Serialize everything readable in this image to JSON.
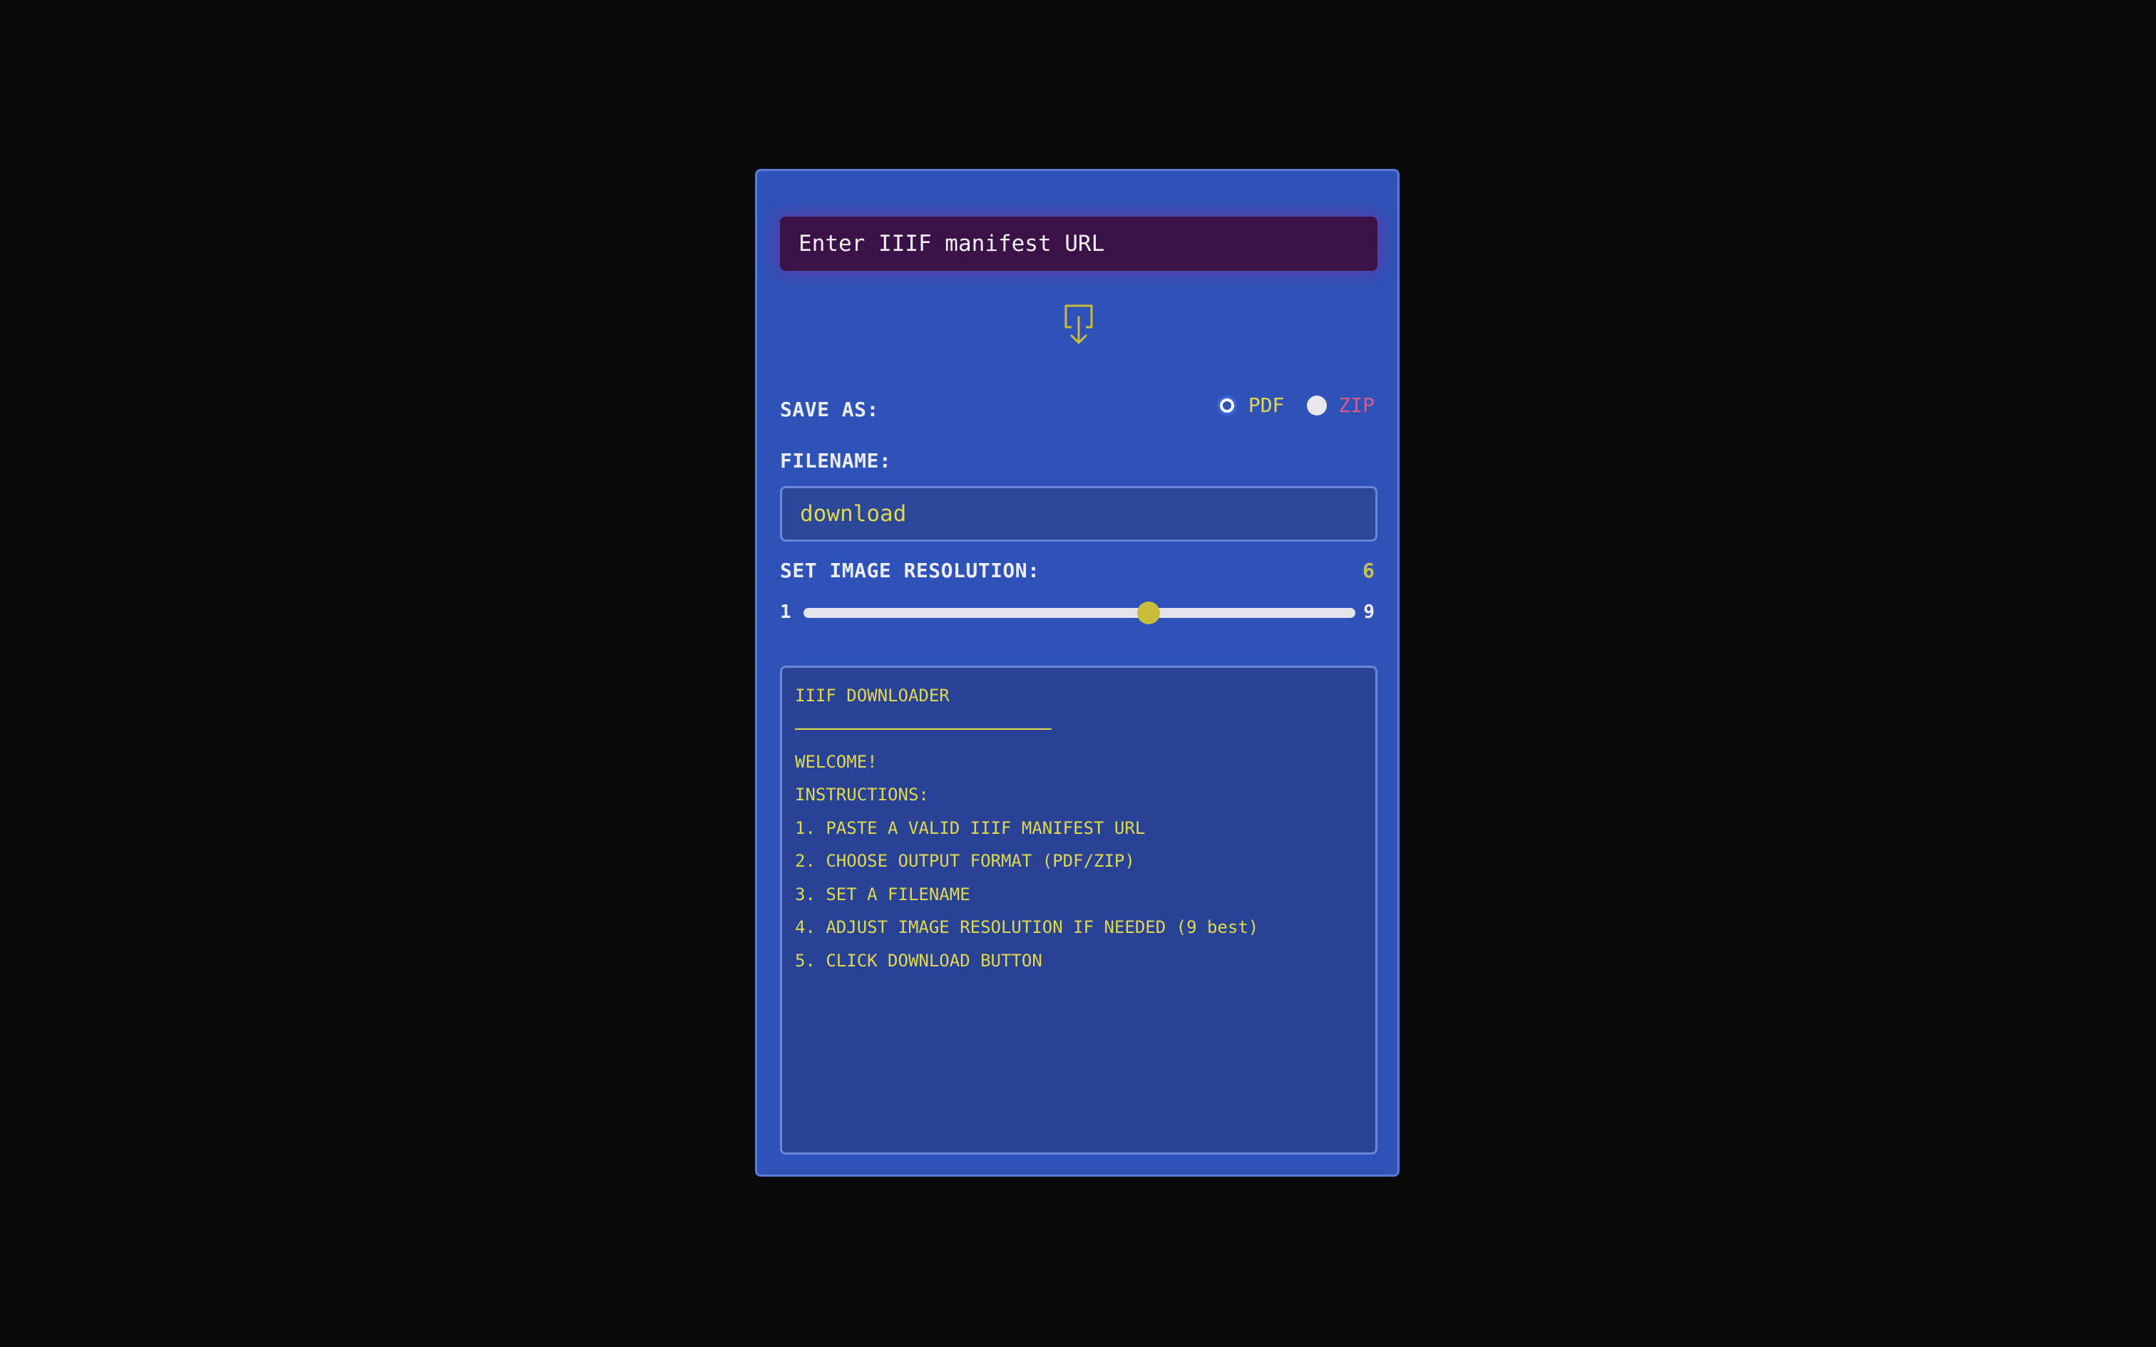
{
  "url_input": {
    "placeholder": "Enter IIIF manifest URL",
    "value": ""
  },
  "download_button": {
    "icon": "download-arrow-icon"
  },
  "save_as": {
    "label": "SAVE AS:",
    "options": [
      {
        "label": "PDF",
        "checked": true
      },
      {
        "label": "ZIP",
        "checked": false
      }
    ]
  },
  "filename": {
    "label": "FILENAME:",
    "value": "download"
  },
  "resolution": {
    "label": "SET IMAGE RESOLUTION:",
    "value": "6",
    "min": "1",
    "max": "9",
    "current": 6
  },
  "console": {
    "title": "IIIF DOWNLOADER",
    "lines": [
      "WELCOME!",
      "INSTRUCTIONS:",
      "1. PASTE A VALID IIIF MANIFEST URL",
      "2. CHOOSE OUTPUT FORMAT (PDF/ZIP)",
      "3. SET A FILENAME",
      "4. ADJUST IMAGE RESOLUTION IF NEEDED (9 best)",
      "5. CLICK DOWNLOAD BUTTON"
    ]
  },
  "colors": {
    "page_background": "#0a0a0a",
    "panel_background": "#2e52b8",
    "url_input_background": "#3a1248",
    "accent_yellow": "#e2d84e",
    "zip_pink": "#d95a8a",
    "slider_thumb": "#c8bd3a"
  }
}
